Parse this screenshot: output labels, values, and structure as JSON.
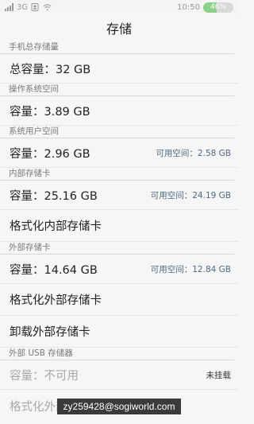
{
  "status": {
    "network": "3G",
    "time": "10:50",
    "battery": "46%",
    "battery_level": 0.46
  },
  "title": "存储",
  "sections": {
    "phone_total": {
      "header": "手机总存储量",
      "capacity": "总容量：32 GB"
    },
    "os_space": {
      "header": "操作系统空间",
      "capacity": "容量：3.89 GB"
    },
    "user_space": {
      "header": "系统用户空间",
      "capacity": "容量：2.96 GB",
      "available": "可用空间：2.58 GB"
    },
    "internal_card": {
      "header": "内部存储卡",
      "capacity": "容量：25.16 GB",
      "available": "可用空间：24.19 GB",
      "format_label": "格式化内部存储卡"
    },
    "external_card": {
      "header": "外部存储卡",
      "capacity": "容量：14.64 GB",
      "available": "可用空间：12.84 GB",
      "format_label": "格式化外部存储卡",
      "unmount_label": "卸载外部存储卡"
    },
    "usb": {
      "header": "外部 USB 存储器",
      "capacity": "容量：不可用",
      "status": "未挂载",
      "format_label": "格式化外部 USB 存储器"
    }
  },
  "watermark": "zy259428@sogiworld.com"
}
